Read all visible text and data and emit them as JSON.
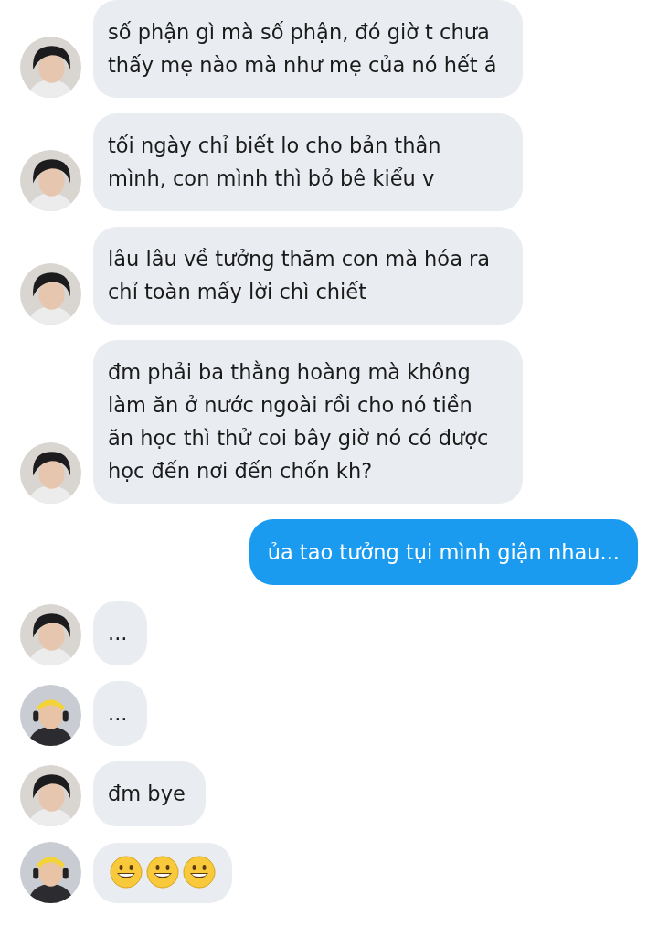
{
  "messages": [
    {
      "outgoing": false,
      "avatar": {
        "kind": "dark"
      },
      "kind": "text",
      "text": "số phận gì mà số phận, đó giờ t chưa thấy mẹ nào mà như mẹ của nó hết á"
    },
    {
      "outgoing": false,
      "avatar": {
        "kind": "dark"
      },
      "kind": "text",
      "text": "tối ngày chỉ biết lo cho bản thân mình, con mình thì bỏ bê kiểu v"
    },
    {
      "outgoing": false,
      "avatar": {
        "kind": "dark"
      },
      "kind": "text",
      "text": "lâu lâu về tưởng thăm con mà hóa ra chỉ toàn mấy lời chì chiết"
    },
    {
      "outgoing": false,
      "avatar": {
        "kind": "dark"
      },
      "kind": "text",
      "text": "đm phải ba thằng hoàng mà không làm ăn ở nước ngoài rồi cho nó tiền ăn học thì thử coi bây giờ nó có được học đến nơi đến chốn kh?"
    },
    {
      "outgoing": true,
      "kind": "text",
      "text": "ủa tao tưởng tụi mình giận nhau..."
    },
    {
      "outgoing": false,
      "avatar": {
        "kind": "dark"
      },
      "kind": "text",
      "text": "..."
    },
    {
      "outgoing": false,
      "avatar": {
        "kind": "headband"
      },
      "kind": "text",
      "text": "..."
    },
    {
      "outgoing": false,
      "avatar": {
        "kind": "dark"
      },
      "kind": "text",
      "text": "đm bye"
    },
    {
      "outgoing": false,
      "avatar": {
        "kind": "headband"
      },
      "kind": "emoji",
      "emojis": [
        {
          "kind": "grinning"
        },
        {
          "kind": "grinning"
        },
        {
          "kind": "grinning"
        }
      ]
    }
  ]
}
